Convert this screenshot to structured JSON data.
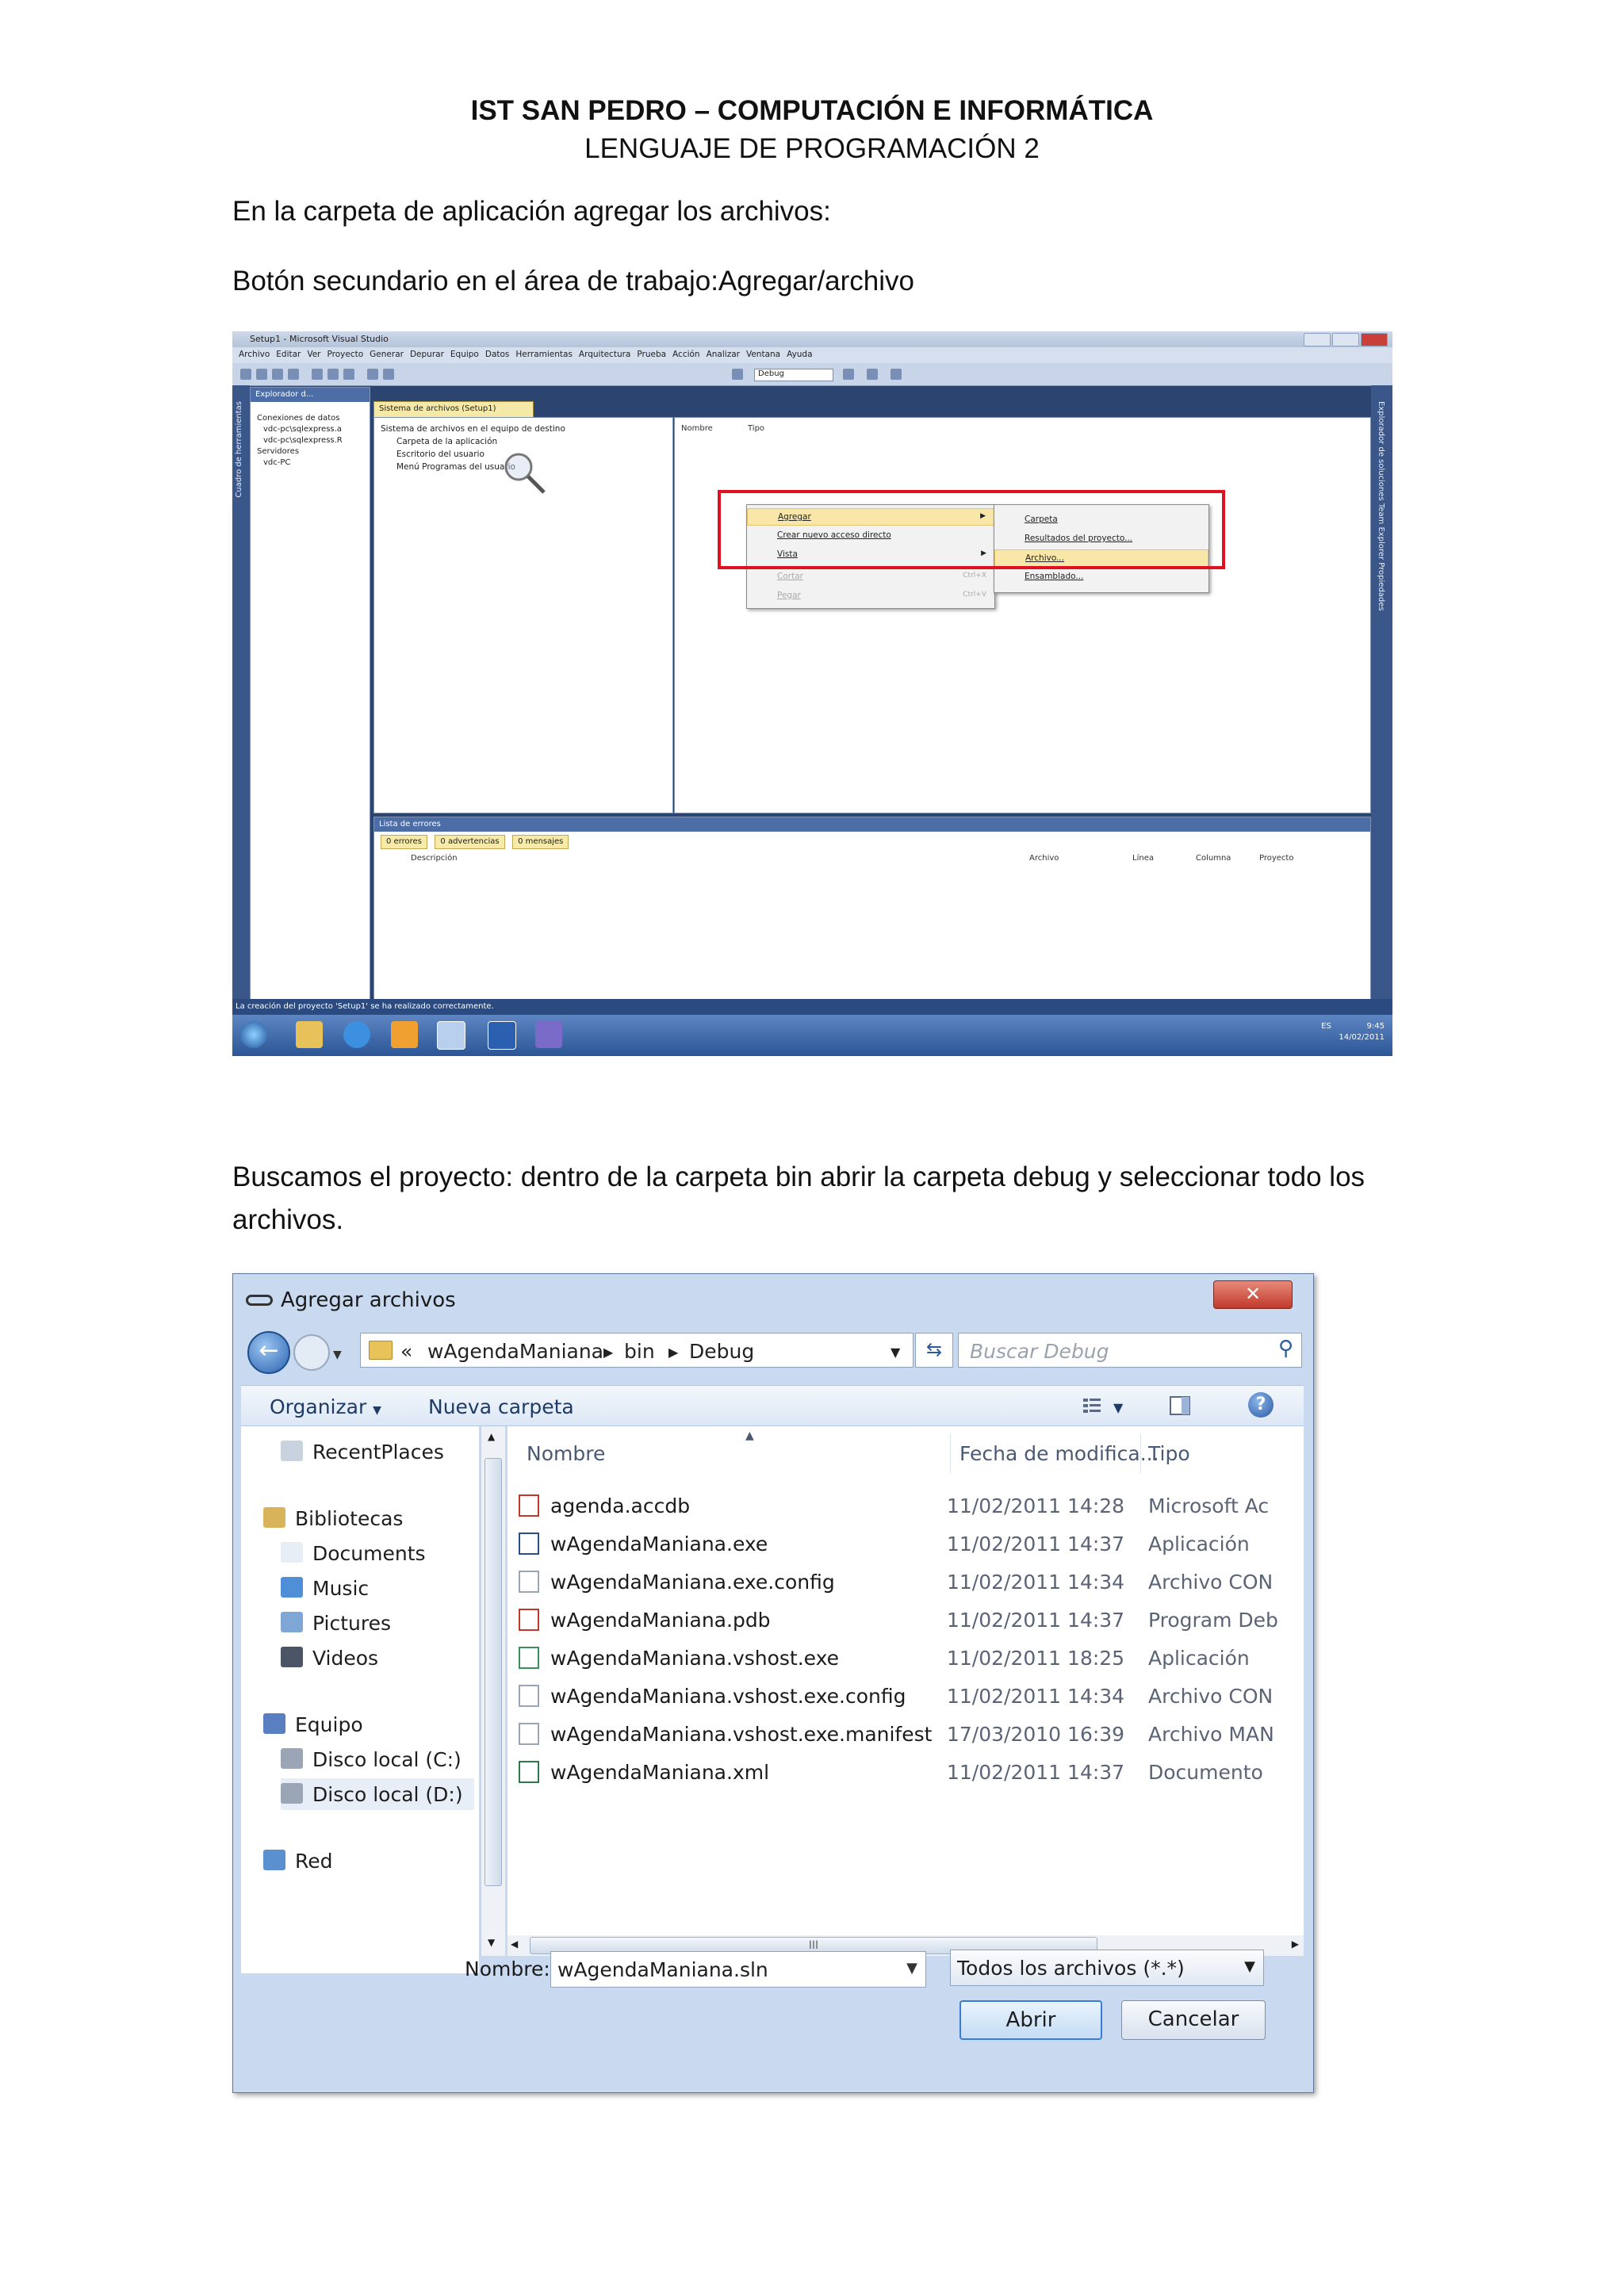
{
  "header": {
    "institution": "IST SAN PEDRO – COMPUTACIÓN E INFORMÁTICA",
    "course": "LENGUAJE DE PROGRAMACIÓN 2"
  },
  "paragraphs": {
    "p1": "En la carpeta de aplicación agregar los archivos:",
    "p2": "Botón secundario en el área de trabajo:Agregar/archivo",
    "p3": "Buscamos el proyecto: dentro de la carpeta bin abrir la carpeta debug y seleccionar todo los archivos."
  },
  "vs_screenshot": {
    "title": "Setup1 - Microsoft Visual Studio",
    "menu": [
      "Archivo",
      "Editar",
      "Ver",
      "Proyecto",
      "Generar",
      "Depurar",
      "Equipo",
      "Datos",
      "Herramientas",
      "Arquitectura",
      "Prueba",
      "Acción",
      "Analizar",
      "Ventana",
      "Ayuda"
    ],
    "config": "Debug",
    "left_vertical_tab": "Cuadro de herramientas",
    "right_vertical_tab": "Explorador de soluciones   Team Explorer   Propiedades",
    "server_explorer": {
      "title": "Explorador d...",
      "items": [
        "Conexiones de datos",
        "vdc-pc\\sqlexpress.a",
        "vdc-pc\\sqlexpress.R",
        "Servidores",
        "vdc-PC"
      ]
    },
    "doc_tab": "Sistema de archivos (Setup1)",
    "fs_tree": [
      "Sistema de archivos en el equipo de destino",
      "Carpeta de la aplicación",
      "Escritorio del usuario",
      "Menú Programas del usuario"
    ],
    "fs_columns": [
      "Nombre",
      "Tipo"
    ],
    "context_menu": [
      {
        "label": "Agregar",
        "submenu": true,
        "disabled": false
      },
      {
        "label": "Crear nuevo acceso directo",
        "submenu": false,
        "disabled": false
      },
      {
        "label": "Vista",
        "submenu": true,
        "disabled": false
      },
      {
        "label": "Cortar",
        "shortcut": "Ctrl+X",
        "disabled": true
      },
      {
        "label": "Pegar",
        "shortcut": "Ctrl+V",
        "disabled": true
      }
    ],
    "submenu": [
      "Carpeta",
      "Resultados del proyecto...",
      "Archivo...",
      "Ensamblado..."
    ],
    "error_list": {
      "title": "Lista de errores",
      "tabs": [
        "0 errores",
        "0 advertencias",
        "0 mensajes"
      ],
      "columns": [
        "Descripción",
        "Archivo",
        "Línea",
        "Columna",
        "Proyecto"
      ]
    },
    "status": "La creación del proyecto 'Setup1' se ha realizado correctamente.",
    "tray": {
      "lang": "ES",
      "time": "9:45",
      "date": "14/02/2011"
    }
  },
  "dialog": {
    "title": "Agregar archivos",
    "close_label": "✕",
    "path": [
      "«",
      "wAgendaManiana",
      "bin",
      "Debug"
    ],
    "search_placeholder": "Buscar Debug",
    "organize": "Organizar",
    "new_folder": "Nueva carpeta",
    "nav": [
      {
        "label": "RecentPlaces",
        "icon": "recent-places-icon"
      },
      {
        "label": "Bibliotecas",
        "icon": "libraries-icon"
      },
      {
        "label": "Documents",
        "icon": "documents-icon"
      },
      {
        "label": "Music",
        "icon": "music-icon"
      },
      {
        "label": "Pictures",
        "icon": "pictures-icon"
      },
      {
        "label": "Videos",
        "icon": "videos-icon"
      },
      {
        "label": "Equipo",
        "icon": "computer-icon"
      },
      {
        "label": "Disco local (C:)",
        "icon": "drive-icon"
      },
      {
        "label": "Disco local (D:)",
        "icon": "drive-icon"
      },
      {
        "label": "Red",
        "icon": "network-icon"
      }
    ],
    "columns": [
      "Nombre",
      "Fecha de modifica...",
      "Tipo"
    ],
    "files": [
      {
        "name": "agenda.accdb",
        "date": "11/02/2011 14:28",
        "type": "Microsoft Ac"
      },
      {
        "name": "wAgendaManiana.exe",
        "date": "11/02/2011 14:37",
        "type": "Aplicación"
      },
      {
        "name": "wAgendaManiana.exe.config",
        "date": "11/02/2011 14:34",
        "type": "Archivo CON"
      },
      {
        "name": "wAgendaManiana.pdb",
        "date": "11/02/2011 14:37",
        "type": "Program Deb"
      },
      {
        "name": "wAgendaManiana.vshost.exe",
        "date": "11/02/2011 18:25",
        "type": "Aplicación"
      },
      {
        "name": "wAgendaManiana.vshost.exe.config",
        "date": "11/02/2011 14:34",
        "type": "Archivo CON"
      },
      {
        "name": "wAgendaManiana.vshost.exe.manifest",
        "date": "17/03/2010 16:39",
        "type": "Archivo MAN"
      },
      {
        "name": "wAgendaManiana.xml",
        "date": "11/02/2011 14:37",
        "type": "Documento"
      }
    ],
    "name_label": "Nombre:",
    "name_value": "wAgendaManiana.sln",
    "filter": "Todos los archivos (*.*)",
    "open_label": "Abrir",
    "cancel_label": "Cancelar",
    "scroll_grip": "III"
  }
}
